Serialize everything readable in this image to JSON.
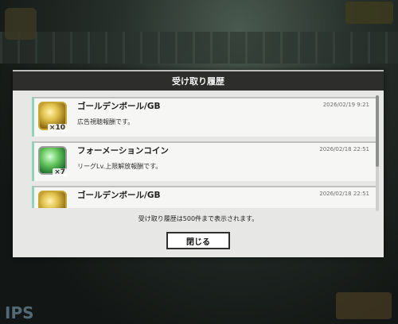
{
  "dialog": {
    "title": "受け取り履歴",
    "hint": "受け取り履歴は500件まで表示されます。",
    "close_label": "閉じる"
  },
  "items": [
    {
      "title": "ゴールデンボール/GB",
      "date": "2026/02/19 9:21",
      "desc": "広告視聴報酬です。",
      "qty": "×10",
      "icon": "golden-ball-icon"
    },
    {
      "title": "フォーメーションコイン",
      "date": "2026/02/18 22:51",
      "desc": "リーグLv.上限解放報酬です。",
      "qty": "×7",
      "icon": "formation-coin-icon"
    },
    {
      "title": "ゴールデンボール/GB",
      "date": "2026/02/18 22:51",
      "desc": "",
      "qty": "",
      "icon": "golden-ball-icon"
    }
  ],
  "background": {
    "tips_text": "IPS"
  },
  "colors": {
    "accent_green": "#8fd4b4",
    "header_dark": "#2d2e2c"
  }
}
